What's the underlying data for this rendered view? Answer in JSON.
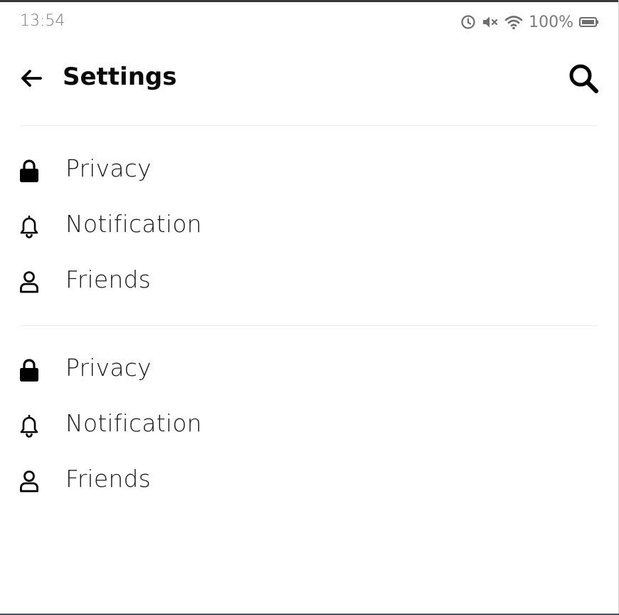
{
  "status_bar": {
    "time": "13:54",
    "icons": [
      "alarm-icon",
      "mute-icon",
      "wifi-icon",
      "battery-icon"
    ],
    "battery_percent": "100%"
  },
  "app_bar": {
    "back_icon": "back-arrow-icon",
    "title": "Settings",
    "search_icon": "search-icon"
  },
  "groups": [
    {
      "items": [
        {
          "icon": "lock-icon",
          "label": "Privacy"
        },
        {
          "icon": "bell-icon",
          "label": "Notification"
        },
        {
          "icon": "person-icon",
          "label": "Friends"
        }
      ]
    },
    {
      "items": [
        {
          "icon": "lock-icon",
          "label": "Privacy"
        },
        {
          "icon": "bell-icon",
          "label": "Notification"
        },
        {
          "icon": "person-icon",
          "label": "Friends"
        }
      ]
    }
  ],
  "colors": {
    "status_text": "#7a7a7a",
    "title": "#0a0a0a",
    "divider": "#ececec",
    "icon": "#000000"
  }
}
